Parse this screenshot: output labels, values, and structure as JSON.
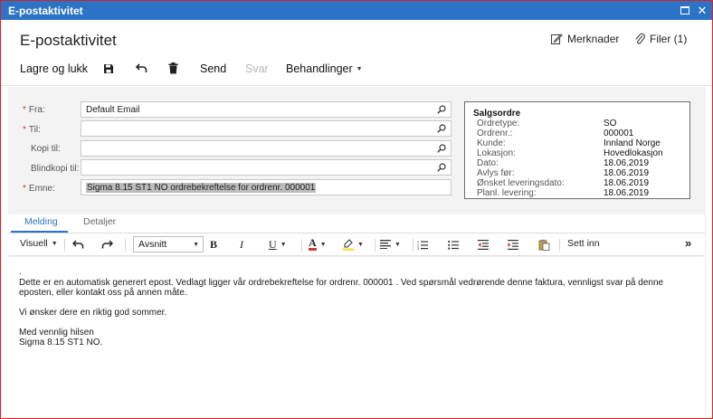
{
  "window": {
    "title": "E-postaktivitet"
  },
  "header": {
    "title": "E-postaktivitet",
    "notes_label": "Merknader",
    "files_label": "Filer (1)"
  },
  "toolbar": {
    "save_close_label": "Lagre og lukk",
    "send_label": "Send",
    "reply_label": "Svar",
    "actions_label": "Behandlinger"
  },
  "form": {
    "from_label": "Fra:",
    "from_value": "Default Email",
    "to_label": "Til:",
    "to_value": "",
    "cc_label": "Kopi til:",
    "cc_value": "",
    "bcc_label": "Blindkopi til:",
    "bcc_value": "",
    "subject_label": "Emne:",
    "subject_value": "Sigma 8.15 ST1 NO ordrebekreftelse for ordrenr. 000001",
    "required_marker": "*"
  },
  "sales_order": {
    "title": "Salgsordre",
    "rows": [
      {
        "label": "Ordretype:",
        "value": "SO"
      },
      {
        "label": "Ordrenr.:",
        "value": "000001"
      },
      {
        "label": "Kunde:",
        "value": "Innland Norge"
      },
      {
        "label": "Lokasjon:",
        "value": "Hovedlokasjon"
      },
      {
        "label": "Dato:",
        "value": "18.06.2019"
      },
      {
        "label": "Avlys før:",
        "value": "18.06.2019"
      },
      {
        "label": "Ønsket leveringsdato:",
        "value": "18.06.2019"
      },
      {
        "label": "Planl. levering:",
        "value": "18.06.2019"
      }
    ]
  },
  "tabs": [
    {
      "label": "Melding"
    },
    {
      "label": "Detaljer"
    }
  ],
  "editor_toolbar": {
    "view_label": "Visuell",
    "paragraph_label": "Avsnitt",
    "bold_label": "B",
    "italic_label": "I",
    "underline_label": "U",
    "font_color_label": "A",
    "insert_label": "Sett inn",
    "more_label": "»"
  },
  "editor": {
    "lines": [
      ".",
      "Dette er en automatisk generert epost. Vedlagt ligger vår ordrebekreftelse for ordrenr. 000001 . Ved spørsmål vedrørende denne faktura, vennligst svar på denne",
      "eposten, eller kontakt oss på annen måte.",
      "",
      "Vi ønsker dere en riktig god sommer.",
      "",
      "Med vennlig hilsen",
      "Sigma 8.15 ST1 NO."
    ]
  },
  "colors": {
    "titlebar": "#2b73c4",
    "accent": "#2b73c4",
    "required": "#d1373a",
    "window_border": "#e11d21"
  }
}
